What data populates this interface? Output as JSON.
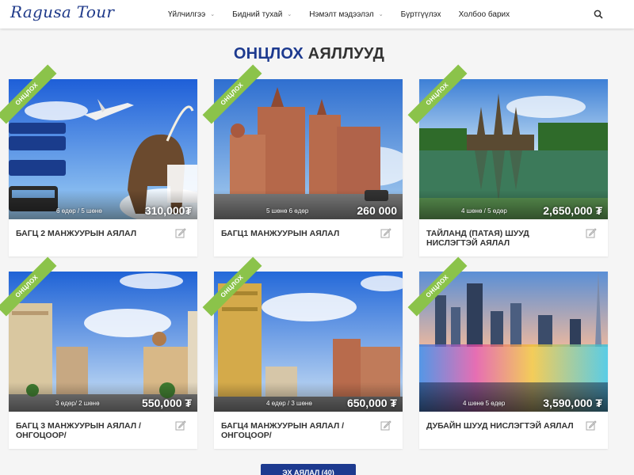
{
  "brand": {
    "logo_text": "Ragusa Tour",
    "accent_color": "#1d3a8f",
    "ribbon_color": "#8bc34a"
  },
  "nav": {
    "items": [
      {
        "label": "Үйлчилгээ",
        "has_dropdown": true
      },
      {
        "label": "Бидний тухай",
        "has_dropdown": true
      },
      {
        "label": "Нэмэлт мэдээлэл",
        "has_dropdown": true
      },
      {
        "label": "Бүртгүүлэх",
        "has_dropdown": false
      },
      {
        "label": "Холбоо барих",
        "has_dropdown": false
      }
    ],
    "caret": "⌄",
    "search_icon": "search-icon"
  },
  "section": {
    "title_accent": "ОНЦЛОХ",
    "title_rest": "АЯЛЛУУД"
  },
  "tours": [
    {
      "ribbon": "ОНЦЛОХ",
      "duration": "6 өдөр / 5 шөнө",
      "price": "310,000₮",
      "title": "БАГЦ 2 МАНЖУУРЫН АЯЛАЛ"
    },
    {
      "ribbon": "ОНЦЛОХ",
      "duration": "5 шөнө 6 өдөр",
      "price": "260 000",
      "title": "БАГЦ1 МАНЖУУРЫН АЯЛАЛ"
    },
    {
      "ribbon": "ОНЦЛОХ",
      "duration": "4 шөнө / 5 өдөр",
      "price": "2,650,000 ₮",
      "title": "ТАЙЛАНД (ПАТАЯ) ШУУД НИСЛЭГТЭЙ АЯЛАЛ"
    },
    {
      "ribbon": "ОНЦЛОХ",
      "duration": "3 өдөр/ 2 шөнө",
      "price": "550,000 ₮",
      "title": "БАГЦ 3 МАНЖУУРЫН АЯЛАЛ / ОНГОЦООР/"
    },
    {
      "ribbon": "ОНЦЛОХ",
      "duration": "4 өдөр / 3 шөнө",
      "price": "650,000 ₮",
      "title": "БАГЦ4 МАНЖУУРЫН АЯЛАЛ / ОНГОЦООР/"
    },
    {
      "ribbon": "ОНЦЛОХ",
      "duration": "4 шөнө 5 өдөр",
      "price": "3,590,000 ₮",
      "title": "ДУБАЙН ШУУД НИСЛЭГТЭЙ АЯЛАЛ"
    }
  ],
  "all_button": {
    "label": "ЭХ АЯЛАЛ (40)"
  }
}
